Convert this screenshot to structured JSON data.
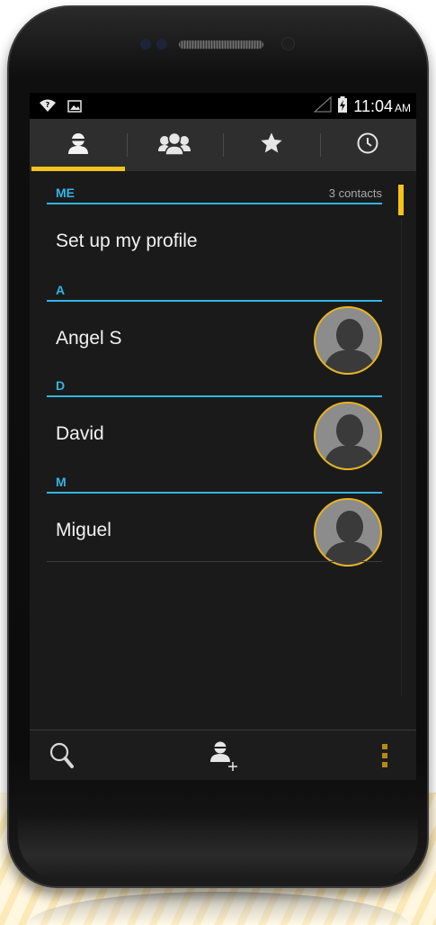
{
  "status_bar": {
    "time": "11:04",
    "ampm": "AM",
    "icons": [
      "wifi-question-icon",
      "image-notification-icon",
      "signal-icon",
      "battery-charging-icon"
    ]
  },
  "tabs": [
    {
      "name": "contacts",
      "icon": "person-icon",
      "active": true
    },
    {
      "name": "groups",
      "icon": "group-icon",
      "active": false
    },
    {
      "name": "favorites",
      "icon": "star-icon",
      "active": false
    },
    {
      "name": "recent",
      "icon": "clock-icon",
      "active": false
    }
  ],
  "sections": {
    "me": {
      "label": "ME",
      "count": "3 contacts",
      "item": "Set up my profile"
    },
    "a": {
      "label": "A",
      "item": "Angel S"
    },
    "d": {
      "label": "D",
      "item": "David"
    },
    "m": {
      "label": "M",
      "item": "Miguel"
    }
  },
  "bottom_bar": {
    "icons": [
      "search-icon",
      "add-contact-icon",
      "overflow-menu-icon"
    ]
  },
  "colors": {
    "accent": "#f7c31a",
    "header": "#33b5e5",
    "background": "#1a1a1a"
  }
}
